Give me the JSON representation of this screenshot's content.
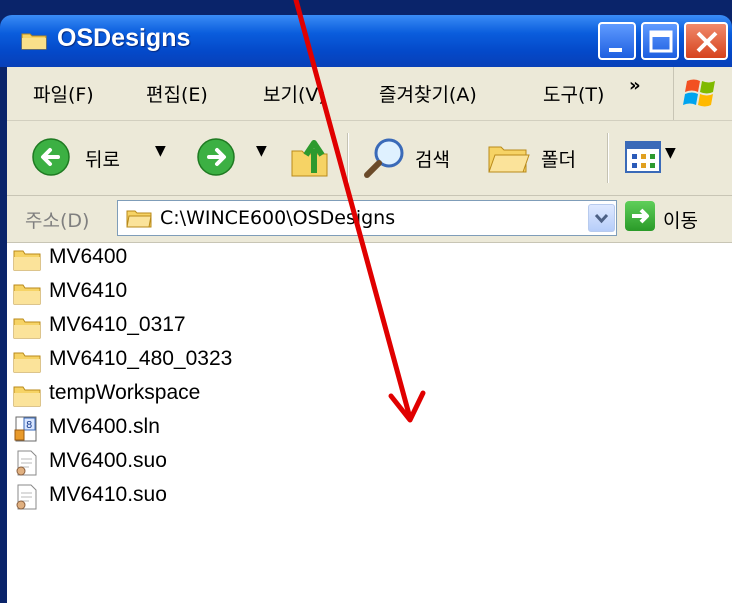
{
  "window": {
    "title": "OSDesigns"
  },
  "menu": [
    "파일(F)",
    "편집(E)",
    "보기(V)",
    "즐겨찾기(A)",
    "도구(T)"
  ],
  "menu_more": "»",
  "toolbar": {
    "back_label": "뒤로",
    "search_label": "검색",
    "folders_label": "폴더"
  },
  "address": {
    "label": "주소(D)",
    "path": "C:\\WINCE600\\OSDesigns",
    "go_label": "이동"
  },
  "files": [
    {
      "name": "MV6400",
      "icon": "folder-icon"
    },
    {
      "name": "MV6410",
      "icon": "folder-icon"
    },
    {
      "name": "MV6410_0317",
      "icon": "folder-icon"
    },
    {
      "name": "MV6410_480_0323",
      "icon": "folder-icon"
    },
    {
      "name": "tempWorkspace",
      "icon": "folder-icon"
    },
    {
      "name": "MV6400.sln",
      "icon": "solution-file-icon"
    },
    {
      "name": "MV6400.suo",
      "icon": "suo-file-icon"
    },
    {
      "name": "MV6410.suo",
      "icon": "suo-file-icon"
    }
  ],
  "colors": {
    "titlebar": "#0a5ddd",
    "chrome": "#ece9d8",
    "annotation_arrow": "#e00000"
  }
}
